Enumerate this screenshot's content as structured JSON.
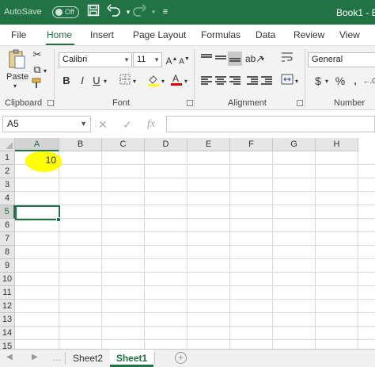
{
  "titlebar": {
    "autosave_label": "AutoSave",
    "autosave_state": "Off",
    "doc_title": "Book1 - E",
    "icons": [
      "save-icon",
      "undo-icon",
      "redo-icon",
      "customize-qat-icon"
    ]
  },
  "tabs": [
    "File",
    "Home",
    "Insert",
    "Page Layout",
    "Formulas",
    "Data",
    "Review",
    "View"
  ],
  "active_tab": "Home",
  "ribbon": {
    "clipboard": {
      "paste_label": "Paste",
      "group_label": "Clipboard"
    },
    "font": {
      "font_name": "Calibri",
      "font_size": "11",
      "bold": "B",
      "italic": "I",
      "underline": "U",
      "group_label": "Font"
    },
    "alignment": {
      "group_label": "Alignment"
    },
    "number": {
      "format": "General",
      "currency": "$",
      "percent": "%",
      "group_label": "Number"
    }
  },
  "formula_bar": {
    "name_box": "A5",
    "cancel": "✕",
    "enter": "✓",
    "fx": "fx",
    "content": ""
  },
  "grid": {
    "columns": [
      "A",
      "B",
      "C",
      "D",
      "E",
      "F",
      "G",
      "H"
    ],
    "rows": [
      "1",
      "2",
      "3",
      "4",
      "5",
      "6",
      "7",
      "8",
      "9",
      "10",
      "11",
      "12",
      "13",
      "14",
      "15"
    ],
    "cell_A1": "10",
    "highlight_color": "#ffff00",
    "selected_cell": "A5"
  },
  "sheets": {
    "tabs": [
      "Sheet2",
      "Sheet1"
    ],
    "active": "Sheet1",
    "add_label": "+"
  },
  "colors": {
    "accent": "#217346"
  }
}
